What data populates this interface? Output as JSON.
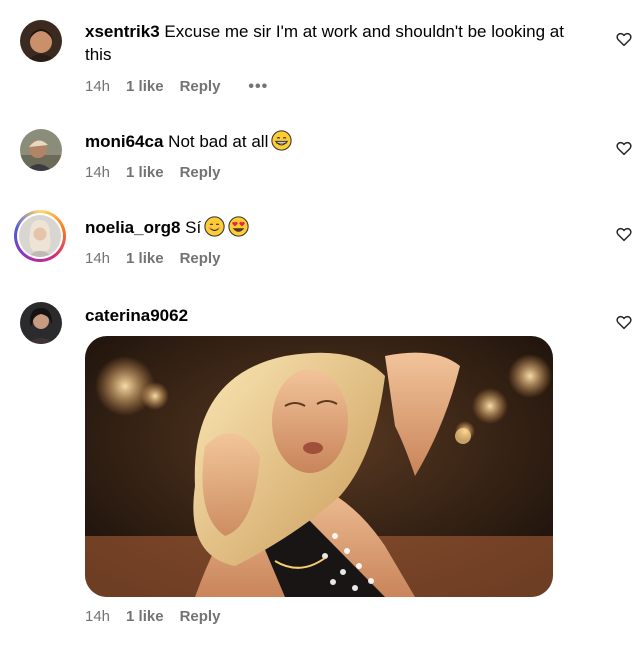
{
  "comments": [
    {
      "username": "xsentrik3",
      "text": "Excuse me sir I'm at work and shouldn't be looking at this",
      "time": "14h",
      "likes": "1 like",
      "reply": "Reply",
      "more": "•••",
      "avatar_icon": "profile-photo"
    },
    {
      "username": "moni64ca",
      "text": "Not bad at all",
      "emojis": [
        "grinning-face-emoji"
      ],
      "time": "14h",
      "likes": "1 like",
      "reply": "Reply",
      "avatar_icon": "profile-photo"
    },
    {
      "username": "noelia_org8",
      "text": "Sí",
      "emojis": [
        "smiling-face-emoji",
        "heart-eyes-emoji"
      ],
      "time": "14h",
      "likes": "1 like",
      "reply": "Reply",
      "avatar_icon": "profile-photo",
      "has_story_ring": true
    },
    {
      "username": "caterina9062",
      "text": "",
      "attachment": "gif",
      "time": "14h",
      "likes": "1 like",
      "reply": "Reply",
      "avatar_icon": "profile-photo"
    }
  ],
  "icons": {
    "like": "heart-outline-icon"
  },
  "colors": {
    "meta": "#737373",
    "text": "#000000",
    "background": "#ffffff"
  }
}
